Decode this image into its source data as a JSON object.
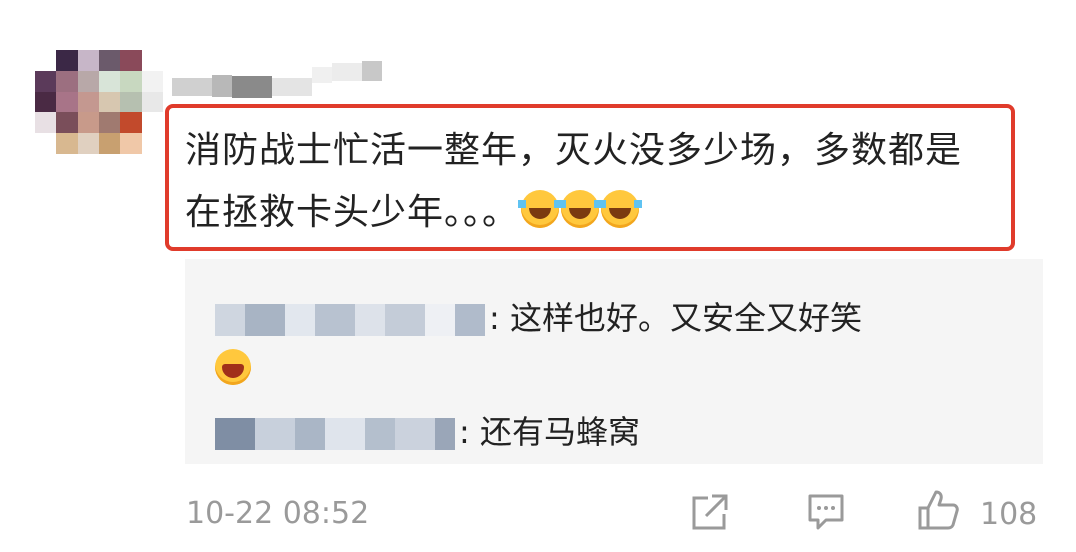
{
  "comment": {
    "text": "消防战士忙活一整年，灭火没多少场，多数都是在拯救卡头少年。。。"
  },
  "replies": [
    {
      "text": ": 这样也好。又安全又好笑"
    },
    {
      "text": ": 还有马蜂窝"
    }
  ],
  "footer": {
    "timestamp": "10-22 08:52",
    "like_count": "108"
  },
  "colors": {
    "highlight_border": "#e03b2b",
    "reply_background": "#f5f5f5",
    "meta_text": "#9a9a9a"
  },
  "icons": {
    "share": "share-icon",
    "reply": "comment-icon",
    "like": "thumbs-up-icon",
    "emoji": "laugh-cry-emoji"
  }
}
